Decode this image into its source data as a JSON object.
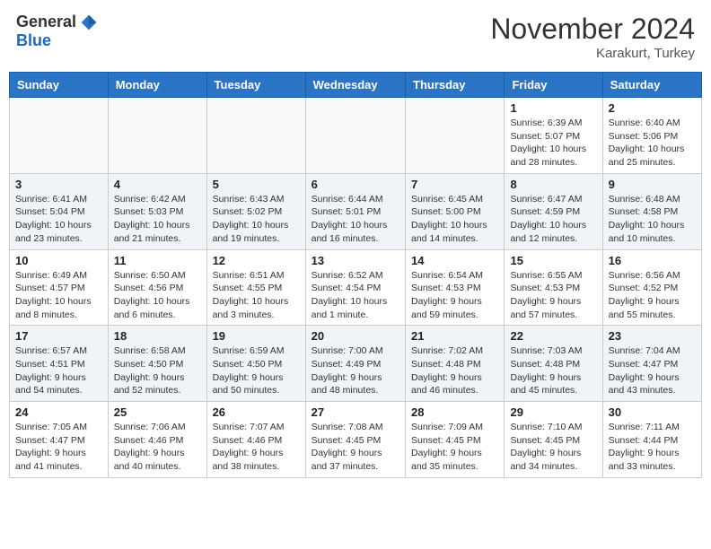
{
  "header": {
    "logo_general": "General",
    "logo_blue": "Blue",
    "month_title": "November 2024",
    "location": "Karakurt, Turkey"
  },
  "days_of_week": [
    "Sunday",
    "Monday",
    "Tuesday",
    "Wednesday",
    "Thursday",
    "Friday",
    "Saturday"
  ],
  "weeks": [
    [
      {
        "day": "",
        "info": ""
      },
      {
        "day": "",
        "info": ""
      },
      {
        "day": "",
        "info": ""
      },
      {
        "day": "",
        "info": ""
      },
      {
        "day": "",
        "info": ""
      },
      {
        "day": "1",
        "info": "Sunrise: 6:39 AM\nSunset: 5:07 PM\nDaylight: 10 hours\nand 28 minutes."
      },
      {
        "day": "2",
        "info": "Sunrise: 6:40 AM\nSunset: 5:06 PM\nDaylight: 10 hours\nand 25 minutes."
      }
    ],
    [
      {
        "day": "3",
        "info": "Sunrise: 6:41 AM\nSunset: 5:04 PM\nDaylight: 10 hours\nand 23 minutes."
      },
      {
        "day": "4",
        "info": "Sunrise: 6:42 AM\nSunset: 5:03 PM\nDaylight: 10 hours\nand 21 minutes."
      },
      {
        "day": "5",
        "info": "Sunrise: 6:43 AM\nSunset: 5:02 PM\nDaylight: 10 hours\nand 19 minutes."
      },
      {
        "day": "6",
        "info": "Sunrise: 6:44 AM\nSunset: 5:01 PM\nDaylight: 10 hours\nand 16 minutes."
      },
      {
        "day": "7",
        "info": "Sunrise: 6:45 AM\nSunset: 5:00 PM\nDaylight: 10 hours\nand 14 minutes."
      },
      {
        "day": "8",
        "info": "Sunrise: 6:47 AM\nSunset: 4:59 PM\nDaylight: 10 hours\nand 12 minutes."
      },
      {
        "day": "9",
        "info": "Sunrise: 6:48 AM\nSunset: 4:58 PM\nDaylight: 10 hours\nand 10 minutes."
      }
    ],
    [
      {
        "day": "10",
        "info": "Sunrise: 6:49 AM\nSunset: 4:57 PM\nDaylight: 10 hours\nand 8 minutes."
      },
      {
        "day": "11",
        "info": "Sunrise: 6:50 AM\nSunset: 4:56 PM\nDaylight: 10 hours\nand 6 minutes."
      },
      {
        "day": "12",
        "info": "Sunrise: 6:51 AM\nSunset: 4:55 PM\nDaylight: 10 hours\nand 3 minutes."
      },
      {
        "day": "13",
        "info": "Sunrise: 6:52 AM\nSunset: 4:54 PM\nDaylight: 10 hours\nand 1 minute."
      },
      {
        "day": "14",
        "info": "Sunrise: 6:54 AM\nSunset: 4:53 PM\nDaylight: 9 hours\nand 59 minutes."
      },
      {
        "day": "15",
        "info": "Sunrise: 6:55 AM\nSunset: 4:53 PM\nDaylight: 9 hours\nand 57 minutes."
      },
      {
        "day": "16",
        "info": "Sunrise: 6:56 AM\nSunset: 4:52 PM\nDaylight: 9 hours\nand 55 minutes."
      }
    ],
    [
      {
        "day": "17",
        "info": "Sunrise: 6:57 AM\nSunset: 4:51 PM\nDaylight: 9 hours\nand 54 minutes."
      },
      {
        "day": "18",
        "info": "Sunrise: 6:58 AM\nSunset: 4:50 PM\nDaylight: 9 hours\nand 52 minutes."
      },
      {
        "day": "19",
        "info": "Sunrise: 6:59 AM\nSunset: 4:50 PM\nDaylight: 9 hours\nand 50 minutes."
      },
      {
        "day": "20",
        "info": "Sunrise: 7:00 AM\nSunset: 4:49 PM\nDaylight: 9 hours\nand 48 minutes."
      },
      {
        "day": "21",
        "info": "Sunrise: 7:02 AM\nSunset: 4:48 PM\nDaylight: 9 hours\nand 46 minutes."
      },
      {
        "day": "22",
        "info": "Sunrise: 7:03 AM\nSunset: 4:48 PM\nDaylight: 9 hours\nand 45 minutes."
      },
      {
        "day": "23",
        "info": "Sunrise: 7:04 AM\nSunset: 4:47 PM\nDaylight: 9 hours\nand 43 minutes."
      }
    ],
    [
      {
        "day": "24",
        "info": "Sunrise: 7:05 AM\nSunset: 4:47 PM\nDaylight: 9 hours\nand 41 minutes."
      },
      {
        "day": "25",
        "info": "Sunrise: 7:06 AM\nSunset: 4:46 PM\nDaylight: 9 hours\nand 40 minutes."
      },
      {
        "day": "26",
        "info": "Sunrise: 7:07 AM\nSunset: 4:46 PM\nDaylight: 9 hours\nand 38 minutes."
      },
      {
        "day": "27",
        "info": "Sunrise: 7:08 AM\nSunset: 4:45 PM\nDaylight: 9 hours\nand 37 minutes."
      },
      {
        "day": "28",
        "info": "Sunrise: 7:09 AM\nSunset: 4:45 PM\nDaylight: 9 hours\nand 35 minutes."
      },
      {
        "day": "29",
        "info": "Sunrise: 7:10 AM\nSunset: 4:45 PM\nDaylight: 9 hours\nand 34 minutes."
      },
      {
        "day": "30",
        "info": "Sunrise: 7:11 AM\nSunset: 4:44 PM\nDaylight: 9 hours\nand 33 minutes."
      }
    ]
  ]
}
